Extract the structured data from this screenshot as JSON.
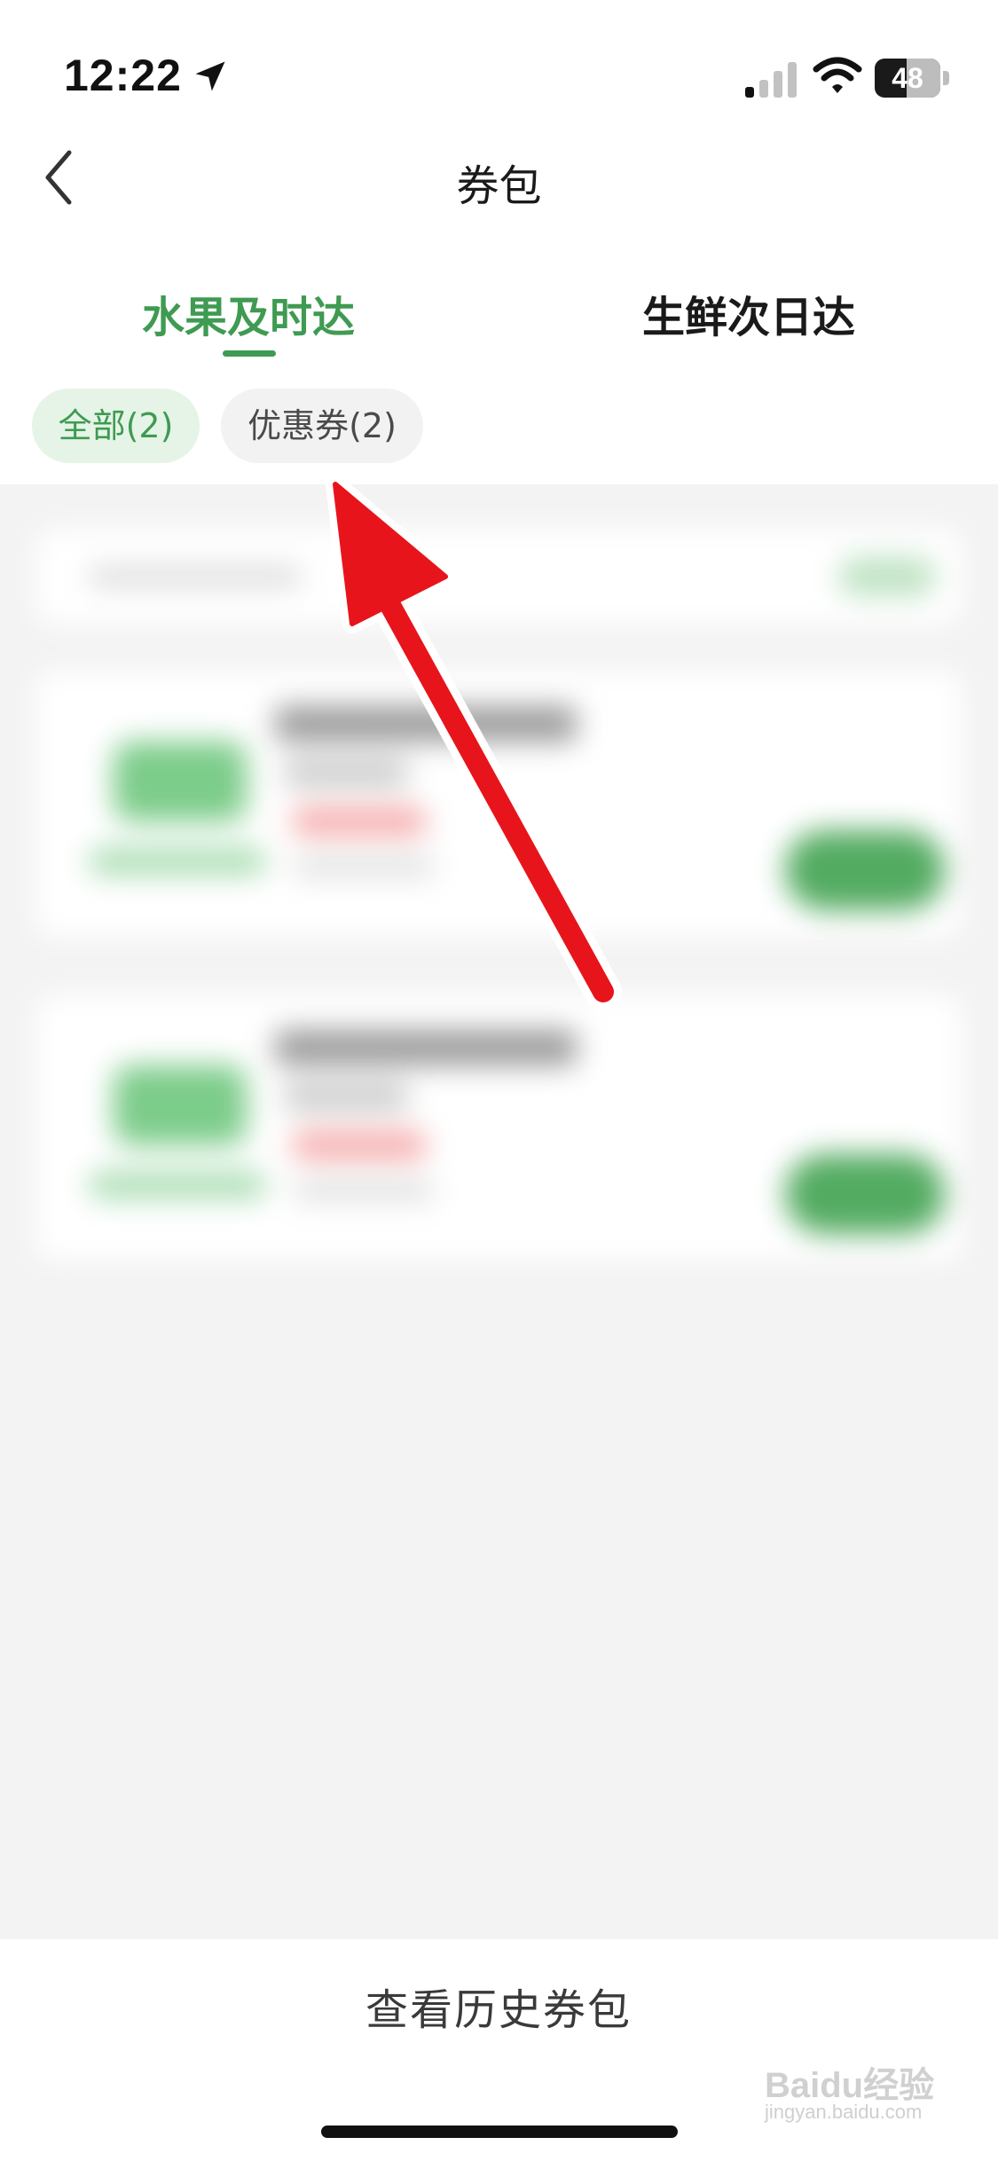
{
  "status_bar": {
    "time": "12:22",
    "battery_percent": 48,
    "battery_label": "48"
  },
  "header": {
    "title": "券包"
  },
  "tabs": [
    {
      "label": "水果及时达",
      "selected": true
    },
    {
      "label": "生鲜次日达",
      "selected": false
    }
  ],
  "filters": [
    {
      "label": "全部(2)",
      "selected": true
    },
    {
      "label": "优惠券(2)",
      "selected": false
    }
  ],
  "footer": {
    "history_label": "查看历史券包"
  },
  "watermark": {
    "brand": "Baidu经验",
    "url": "jingyan.baidu.com"
  },
  "colors": {
    "accent_green": "#3f9a52",
    "chip_selected_bg": "#e5f4e7",
    "annotation_arrow": "#e8141b"
  }
}
